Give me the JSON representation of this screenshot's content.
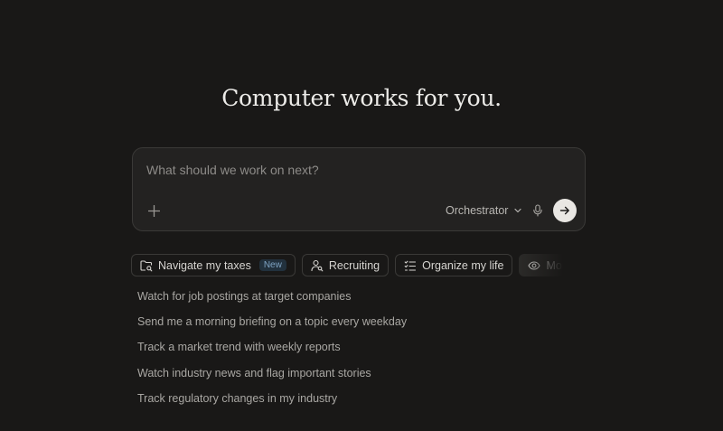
{
  "hero": {
    "title": "Computer works for you."
  },
  "composer": {
    "placeholder": "What should we work on next?",
    "value": "",
    "model_label": "Orchestrator",
    "icons": {
      "attach": "plus-icon",
      "model_dropdown": "chevron-down-icon",
      "mic": "microphone-icon",
      "send": "arrow-right-icon"
    }
  },
  "chips": [
    {
      "label": "Navigate my taxes",
      "icon": "folder-search-icon",
      "badge": "New"
    },
    {
      "label": "Recruiting",
      "icon": "user-search-icon"
    },
    {
      "label": "Organize my life",
      "icon": "checklist-icon"
    },
    {
      "label": "Monitor the",
      "icon": "eye-icon",
      "active": true
    }
  ],
  "suggestions": [
    "Watch for job postings at target companies",
    "Send me a morning briefing on a topic every weekday",
    "Track a market trend with weekly reports",
    "Watch industry news and flag important stories",
    "Track regulatory changes in my industry"
  ],
  "colors": {
    "background": "#191817",
    "surface": "#232221",
    "border": "#3a3937",
    "text_primary": "#ecebe8",
    "text_secondary": "#a9a7a3",
    "badge_text": "#7fa4c4",
    "send_button": "#e9e7e3"
  }
}
